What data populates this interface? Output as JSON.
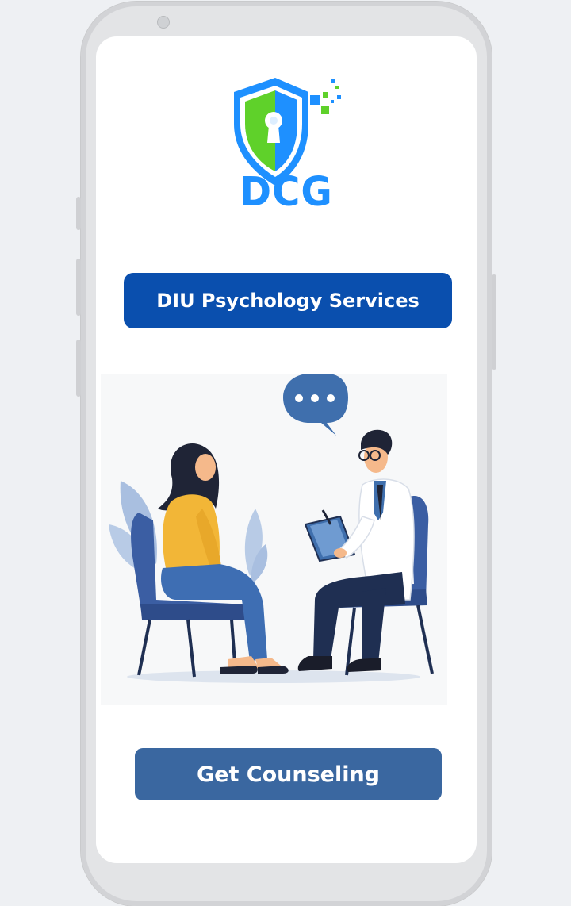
{
  "logo": {
    "text": "DCG",
    "colors": {
      "shield_blue": "#1e90ff",
      "shield_green": "#5fd12a"
    }
  },
  "header_pill": {
    "label": "DIU Psychology Services",
    "color": "#0a4fae"
  },
  "illustration": {
    "name": "counseling-session-illustration",
    "bubble_icon": "speech-bubble-ellipsis-icon"
  },
  "cta": {
    "label": "Get Counseling",
    "color": "#3a67a0"
  }
}
